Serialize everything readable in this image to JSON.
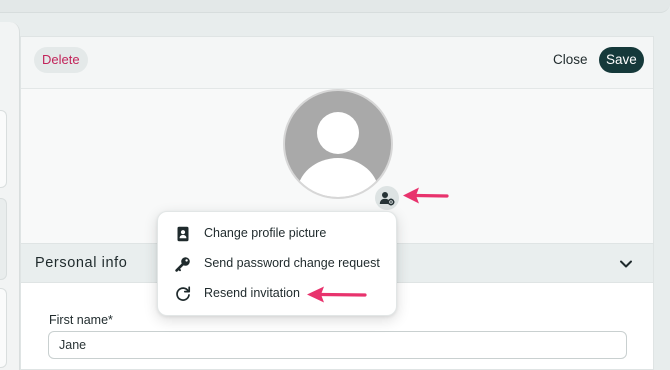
{
  "header": {
    "delete_label": "Delete",
    "close_label": "Close",
    "save_label": "Save"
  },
  "avatar": {
    "icon": "user-avatar-placeholder",
    "manage_icon": "user-gear-icon"
  },
  "menu": {
    "items": [
      {
        "label": "Change profile picture",
        "icon": "contact-card-icon"
      },
      {
        "label": "Send password change request",
        "icon": "key-icon"
      },
      {
        "label": "Resend invitation",
        "icon": "refresh-icon"
      }
    ]
  },
  "section": {
    "title": "Personal info",
    "toggle_icon": "chevron-down-icon"
  },
  "form": {
    "first_name_label": "First name*",
    "first_name_value": "Jane"
  },
  "colors": {
    "accent_dark": "#15393a",
    "danger": "#c2245a",
    "annotation_arrow": "#e8336d"
  }
}
